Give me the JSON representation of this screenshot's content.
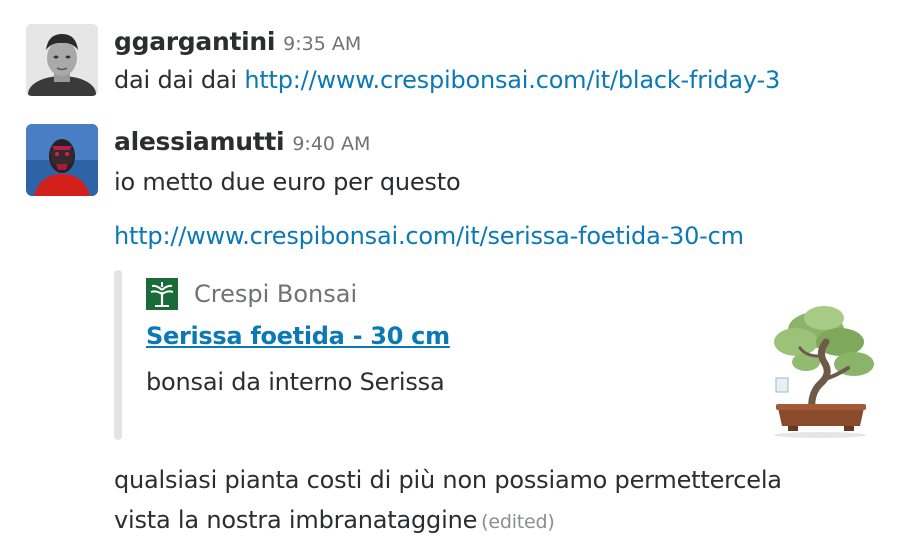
{
  "messages": [
    {
      "sender": "ggargantini",
      "time": "9:35 AM",
      "text_prefix": "dai dai dai ",
      "link": "http://www.crespibonsai.com/it/black-friday-3"
    },
    {
      "sender": "alessiamutti",
      "time": "9:40 AM",
      "text": "io metto due euro per questo",
      "link": "http://www.crespibonsai.com/it/serissa-foetida-30-cm",
      "attachment": {
        "service_name": "Crespi Bonsai",
        "title": "Serissa foetida - 30 cm",
        "description": "bonsai da interno Serissa"
      },
      "followup_line1": "qualsiasi pianta costi di più non possiamo permettercela",
      "followup_line2": "vista la nostra imbranataggine",
      "edited_label": "(edited)"
    }
  ],
  "colors": {
    "link": "#0b79b6",
    "text": "#2c2d30",
    "muted": "#717274",
    "attachment_bar": "#e3e3e3",
    "brand_green": "#1b6b3a"
  },
  "icons": {
    "service": "crespi-bonsai-logo-icon"
  }
}
